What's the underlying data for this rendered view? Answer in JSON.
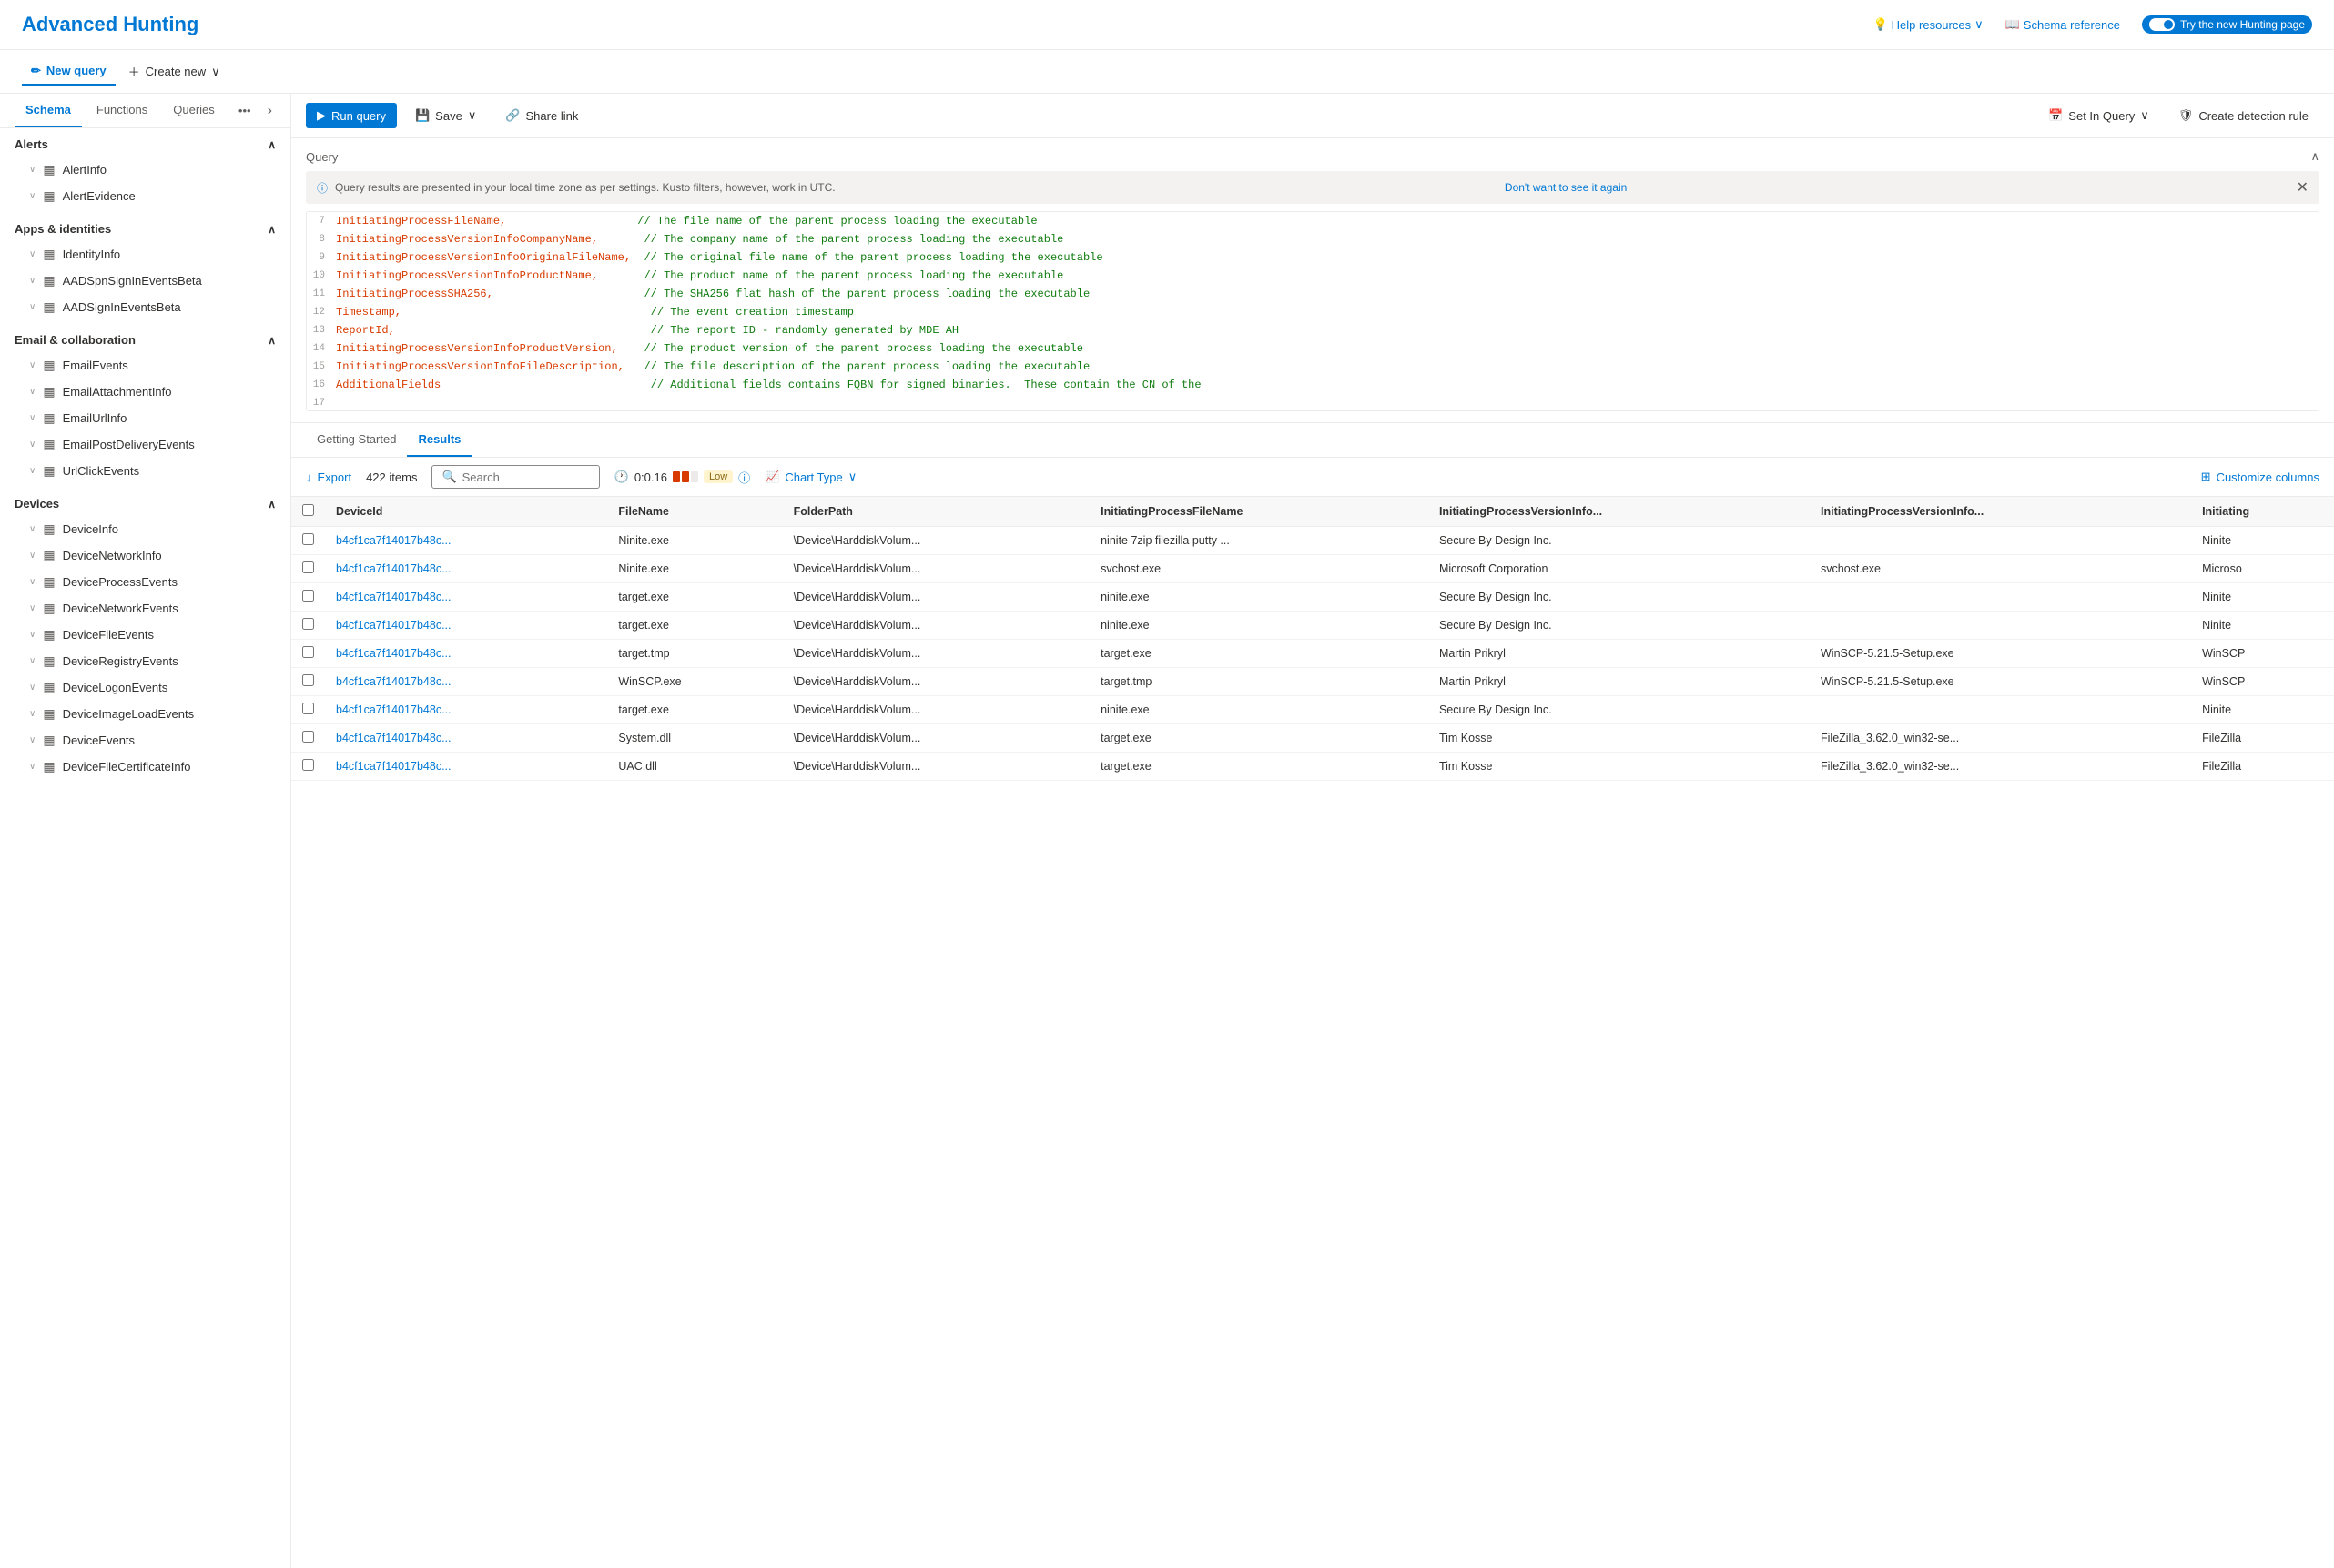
{
  "header": {
    "title": "Advanced Hunting",
    "help_label": "Help resources",
    "schema_label": "Schema reference",
    "toggle_label": "Try the new Hunting page"
  },
  "action_bar": {
    "new_query_label": "New query",
    "create_new_label": "Create new",
    "run_query_label": "Run query",
    "save_label": "Save",
    "share_link_label": "Share link",
    "set_in_query_label": "Set In Query",
    "create_detection_rule_label": "Create detection rule"
  },
  "sidebar": {
    "tabs": [
      "Schema",
      "Functions",
      "Queries"
    ],
    "active_tab": "Schema",
    "collapse_tooltip": "Collapse",
    "sections": [
      {
        "name": "Alerts",
        "expanded": true,
        "items": [
          {
            "label": "AlertInfo",
            "icon": "table"
          },
          {
            "label": "AlertEvidence",
            "icon": "table"
          }
        ]
      },
      {
        "name": "Apps & identities",
        "expanded": true,
        "items": [
          {
            "label": "IdentityInfo",
            "icon": "table"
          },
          {
            "label": "AADSpnSignInEventsBeta",
            "icon": "table"
          },
          {
            "label": "AADSignInEventsBeta",
            "icon": "table"
          }
        ]
      },
      {
        "name": "Email & collaboration",
        "expanded": true,
        "items": [
          {
            "label": "EmailEvents",
            "icon": "table"
          },
          {
            "label": "EmailAttachmentInfo",
            "icon": "table"
          },
          {
            "label": "EmailUrlInfo",
            "icon": "table"
          },
          {
            "label": "EmailPostDeliveryEvents",
            "icon": "table"
          },
          {
            "label": "UrlClickEvents",
            "icon": "table"
          }
        ]
      },
      {
        "name": "Devices",
        "expanded": true,
        "items": [
          {
            "label": "DeviceInfo",
            "icon": "table"
          },
          {
            "label": "DeviceNetworkInfo",
            "icon": "table"
          },
          {
            "label": "DeviceProcessEvents",
            "icon": "table"
          },
          {
            "label": "DeviceNetworkEvents",
            "icon": "table"
          },
          {
            "label": "DeviceFileEvents",
            "icon": "table"
          },
          {
            "label": "DeviceRegistryEvents",
            "icon": "table"
          },
          {
            "label": "DeviceLogonEvents",
            "icon": "table"
          },
          {
            "label": "DeviceImageLoadEvents",
            "icon": "table"
          },
          {
            "label": "DeviceEvents",
            "icon": "table"
          },
          {
            "label": "DeviceFileCertificateInfo",
            "icon": "table"
          }
        ]
      }
    ]
  },
  "query": {
    "section_label": "Query",
    "info_text": "Query results are presented in your local time zone as per settings. Kusto filters, however, work in UTC.",
    "dismiss_label": "Don't want to see it again",
    "lines": [
      {
        "num": "7",
        "content": "InitiatingProcessFileName,",
        "comment": "// The file name of the parent process loading the executable"
      },
      {
        "num": "8",
        "content": "InitiatingProcessVersionInfoCompanyName,",
        "comment": "// The company name of the parent process loading the executable"
      },
      {
        "num": "9",
        "content": "InitiatingProcessVersionInfoOriginalFileName,",
        "comment": "// The original file name of the parent process loading the executable"
      },
      {
        "num": "10",
        "content": "InitiatingProcessVersionInfoProductName,",
        "comment": "// The product name of the parent process loading the executable"
      },
      {
        "num": "11",
        "content": "InitiatingProcessSHA256,",
        "comment": "// The SHA256 flat hash of the parent process loading the executable"
      },
      {
        "num": "12",
        "content": "Timestamp,",
        "comment": "// The event creation timestamp"
      },
      {
        "num": "13",
        "content": "ReportId,",
        "comment": "// The report ID - randomly generated by MDE AH"
      },
      {
        "num": "14",
        "content": "InitiatingProcessVersionInfoProductVersion,",
        "comment": "// The product version of the parent process loading the executable"
      },
      {
        "num": "15",
        "content": "InitiatingProcessVersionInfoFileDescription,",
        "comment": "// The file description of the parent process loading the executable"
      },
      {
        "num": "16",
        "content": "AdditionalFields",
        "comment": "// Additional fields contains FQBN for signed binaries.  These contain the CN of the"
      },
      {
        "num": "17",
        "content": "",
        "comment": ""
      }
    ]
  },
  "results": {
    "getting_started_label": "Getting Started",
    "results_label": "Results",
    "export_label": "Export",
    "item_count": "422 items",
    "search_placeholder": "Search",
    "time_display": "0:0.16",
    "perf_level": "Low",
    "chart_type_label": "Chart Type",
    "customize_columns_label": "Customize columns",
    "columns": [
      "DeviceId",
      "FileName",
      "FolderPath",
      "InitiatingProcessFileName",
      "InitiatingProcessVersionInfo...",
      "InitiatingProcessVersionInfo...",
      "Initiating"
    ],
    "rows": [
      {
        "deviceId": "b4cf1ca7f14017b48c...",
        "fileName": "Ninite.exe",
        "folderPath": "\\Device\\HarddiskVolum...",
        "initProcFileName": "ninite 7zip filezilla putty ...",
        "col5": "Secure By Design Inc.",
        "col6": "",
        "col7": "Ninite"
      },
      {
        "deviceId": "b4cf1ca7f14017b48c...",
        "fileName": "Ninite.exe",
        "folderPath": "\\Device\\HarddiskVolum...",
        "initProcFileName": "svchost.exe",
        "col5": "Microsoft Corporation",
        "col6": "svchost.exe",
        "col7": "Microso"
      },
      {
        "deviceId": "b4cf1ca7f14017b48c...",
        "fileName": "target.exe",
        "folderPath": "\\Device\\HarddiskVolum...",
        "initProcFileName": "ninite.exe",
        "col5": "Secure By Design Inc.",
        "col6": "",
        "col7": "Ninite"
      },
      {
        "deviceId": "b4cf1ca7f14017b48c...",
        "fileName": "target.exe",
        "folderPath": "\\Device\\HarddiskVolum...",
        "initProcFileName": "ninite.exe",
        "col5": "Secure By Design Inc.",
        "col6": "",
        "col7": "Ninite"
      },
      {
        "deviceId": "b4cf1ca7f14017b48c...",
        "fileName": "target.tmp",
        "folderPath": "\\Device\\HarddiskVolum...",
        "initProcFileName": "target.exe",
        "col5": "Martin Prikryl",
        "col6": "WinSCP-5.21.5-Setup.exe",
        "col7": "WinSCP"
      },
      {
        "deviceId": "b4cf1ca7f14017b48c...",
        "fileName": "WinSCP.exe",
        "folderPath": "\\Device\\HarddiskVolum...",
        "initProcFileName": "target.tmp",
        "col5": "Martin Prikryl",
        "col6": "WinSCP-5.21.5-Setup.exe",
        "col7": "WinSCP"
      },
      {
        "deviceId": "b4cf1ca7f14017b48c...",
        "fileName": "target.exe",
        "folderPath": "\\Device\\HarddiskVolum...",
        "initProcFileName": "ninite.exe",
        "col5": "Secure By Design Inc.",
        "col6": "",
        "col7": "Ninite"
      },
      {
        "deviceId": "b4cf1ca7f14017b48c...",
        "fileName": "System.dll",
        "folderPath": "\\Device\\HarddiskVolum...",
        "initProcFileName": "target.exe",
        "col5": "Tim Kosse",
        "col6": "FileZilla_3.62.0_win32-se...",
        "col7": "FileZilla"
      },
      {
        "deviceId": "b4cf1ca7f14017b48c...",
        "fileName": "UAC.dll",
        "folderPath": "\\Device\\HarddiskVolum...",
        "initProcFileName": "target.exe",
        "col5": "Tim Kosse",
        "col6": "FileZilla_3.62.0_win32-se...",
        "col7": "FileZilla"
      }
    ]
  }
}
